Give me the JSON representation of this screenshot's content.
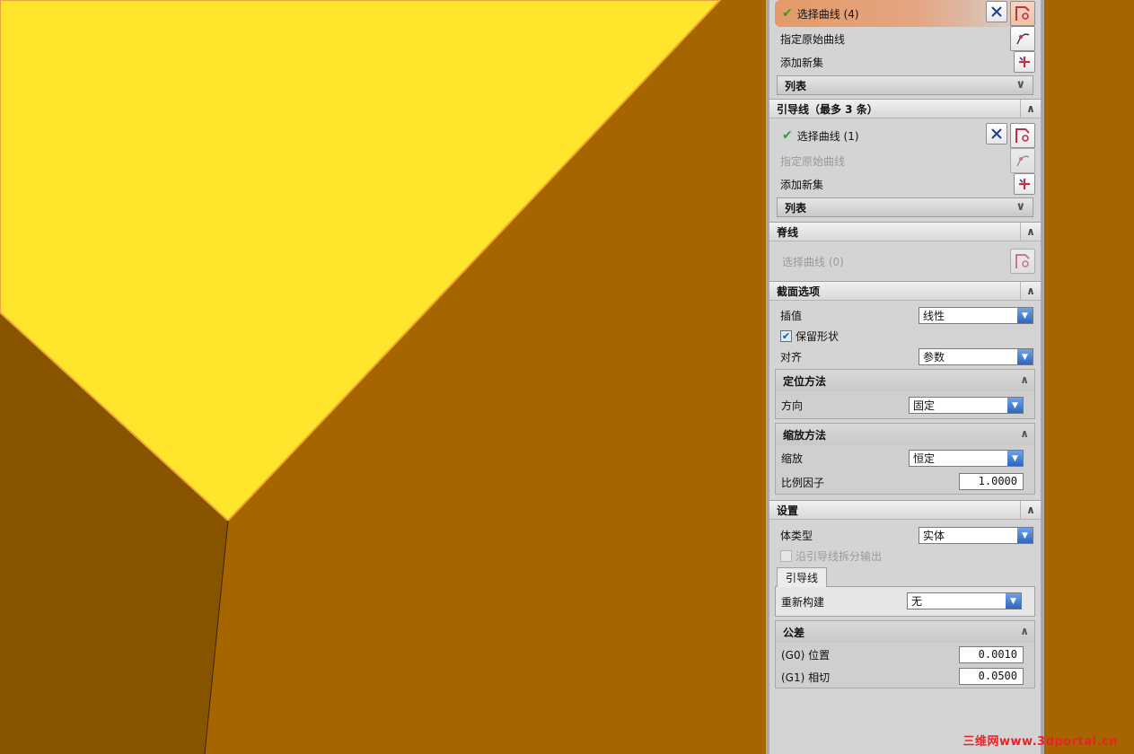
{
  "colors": {
    "viewport_bg": "#a76500",
    "face_yellow": "#ffe52b",
    "face_dark": "#875400",
    "accent_selection": "#e59a66",
    "panel_bg": "#d4d4d4"
  },
  "section_lines": {
    "select_curve_label": "选择曲线 (4)",
    "specify_original_label": "指定原始曲线",
    "add_new_set_label": "添加新集",
    "list_label": "列表"
  },
  "guide": {
    "header": "引导线（最多 3 条）",
    "select_curve_label": "选择曲线 (1)",
    "specify_original_label": "指定原始曲线",
    "add_new_set_label": "添加新集",
    "list_label": "列表"
  },
  "spine": {
    "header": "脊线",
    "select_curve_label": "选择曲线 (0)"
  },
  "section_options": {
    "header": "截面选项",
    "interpolation_label": "插值",
    "interpolation_value": "线性",
    "preserve_shape_label": "保留形状",
    "alignment_label": "对齐",
    "alignment_value": "参数",
    "orientation": {
      "header": "定位方法",
      "direction_label": "方向",
      "direction_value": "固定"
    },
    "scaling": {
      "header": "缩放方法",
      "scale_label": "缩放",
      "scale_value": "恒定",
      "factor_label": "比例因子",
      "factor_value": "1.0000"
    }
  },
  "settings": {
    "header": "设置",
    "body_type_label": "体类型",
    "body_type_value": "实体",
    "split_output_label": "沿引导线拆分输出",
    "tab_label": "引导线",
    "rebuild_label": "重新构建",
    "rebuild_value": "无",
    "tolerance": {
      "header": "公差",
      "g0_label": "(G0) 位置",
      "g0_value": "0.0010",
      "g1_label": "(G1) 相切",
      "g1_value": "0.0500"
    }
  },
  "watermark": "三维网www.3dportal.cn"
}
